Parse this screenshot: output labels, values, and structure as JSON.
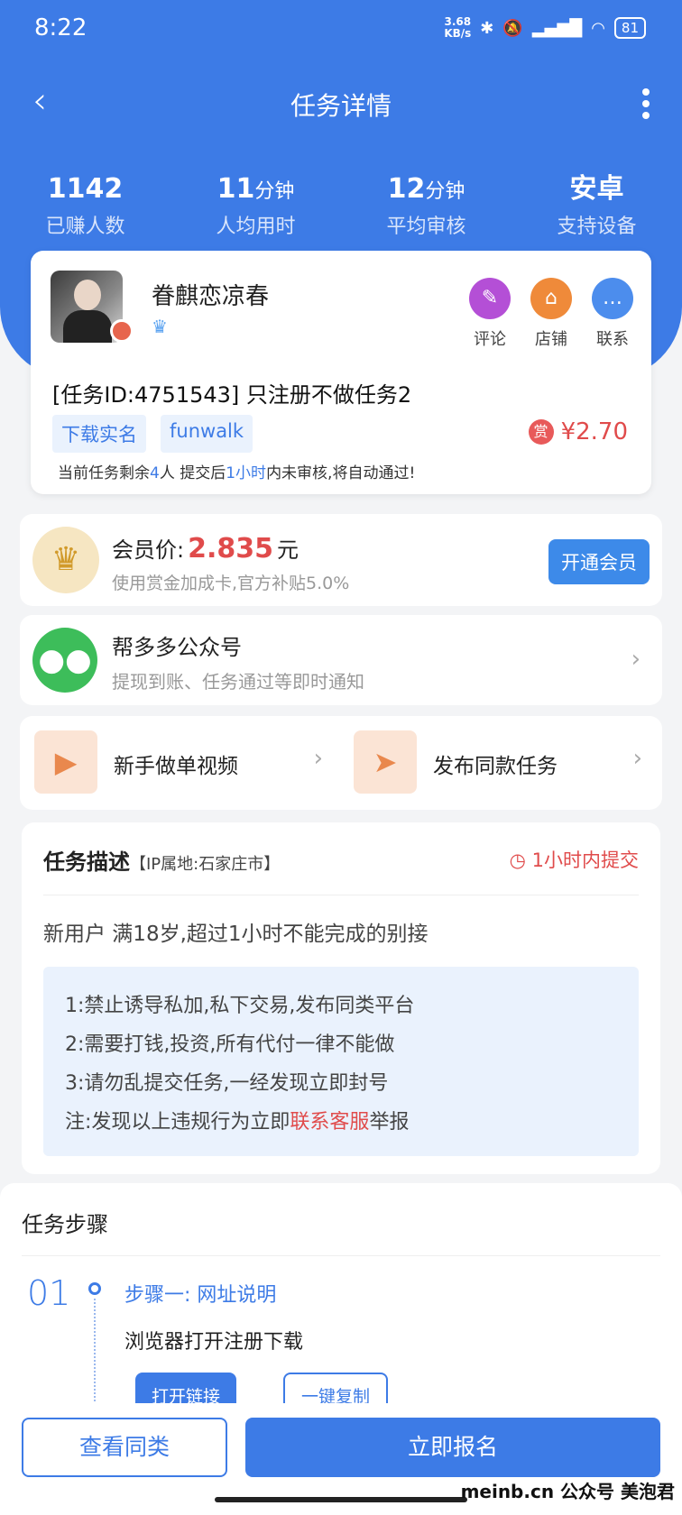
{
  "status": {
    "time": "8:22",
    "net_speed_value": "3.68",
    "net_speed_unit": "KB/s",
    "battery": "81"
  },
  "nav": {
    "title": "任务详情"
  },
  "stats": [
    {
      "value": "1142",
      "unit": "",
      "label": "已赚人数"
    },
    {
      "value": "11",
      "unit": "分钟",
      "label": "人均用时"
    },
    {
      "value": "12",
      "unit": "分钟",
      "label": "平均审核"
    },
    {
      "value": "安卓",
      "unit": "",
      "label": "支持设备"
    }
  ],
  "publisher": {
    "name": "眷麒恋凉春"
  },
  "actions": [
    {
      "label": "评论",
      "icon": "comment-icon",
      "color": "#b44fd6"
    },
    {
      "label": "店铺",
      "icon": "shop-icon",
      "color": "#ef8a3a"
    },
    {
      "label": "联系",
      "icon": "chat-icon",
      "color": "#4c8ded"
    }
  ],
  "task": {
    "title": "[任务ID:4751543] 只注册不做任务2",
    "tags": [
      "下载实名",
      "funwalk"
    ],
    "reward_badge": "赏",
    "reward": "¥2.70",
    "note_prefix": "当前任务剩余",
    "note_count": "4",
    "note_mid": "人  提交后",
    "note_time": "1小时",
    "note_suffix": "内未审核,将自动通过!"
  },
  "vip": {
    "label": "会员价:",
    "price": "2.835",
    "unit": "元",
    "sub": "使用赏金加成卡,官方补贴5.0%",
    "button": "开通会员"
  },
  "wechat": {
    "title": "帮多多公众号",
    "sub": "提现到账、任务通过等即时通知"
  },
  "shortcuts": [
    {
      "label": "新手做单视频"
    },
    {
      "label": "发布同款任务"
    }
  ],
  "description": {
    "heading": "任务描述",
    "ip": "【IP属地:石家庄市】",
    "time_limit": "1小时内提交",
    "text": "新用户 满18岁,超过1小时不能完成的别接",
    "rules": [
      "1:禁止诱导私加,私下交易,发布同类平台",
      "2:需要打钱,投资,所有代付一律不能做",
      "3:请勿乱提交任务,一经发现立即封号"
    ],
    "rule4_prefix": "注:发现以上违规行为立即",
    "rule4_link": "联系客服",
    "rule4_suffix": "举报"
  },
  "steps": {
    "heading": "任务步骤",
    "num": "01",
    "title": "步骤一: 网址说明",
    "desc": "浏览器打开注册下载",
    "open_button": "打开链接",
    "copy_button": "一键复制"
  },
  "bottom": {
    "similar": "查看同类",
    "signup": "立即报名"
  },
  "watermark": "meinb.cn 公众号 美泡君"
}
